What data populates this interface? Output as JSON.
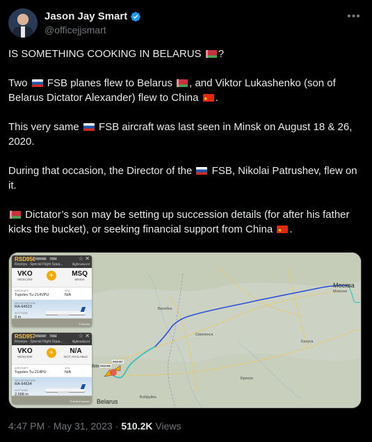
{
  "author": {
    "display_name": "Jason Jay Smart",
    "handle": "@officejjsmart",
    "verified_icon": "verified-badge-icon",
    "more_icon": "more-options-icon"
  },
  "tweet": {
    "p1": [
      "IS SOMETHING COOKING IN BELARUS ",
      "?"
    ],
    "p2": [
      "Two ",
      " FSB planes flew to Belarus ",
      ", and Viktor Lukashenko (son of Belarus Dictator Alexander) flew to China ",
      "."
    ],
    "p3": [
      "This very same ",
      " FSB aircraft was last seen in Minsk on August 18 & 26, 2020."
    ],
    "p4": [
      "During that occasion, the Director of the ",
      " FSB, Nikolai Patrushev, flew on it."
    ],
    "p5": [
      " Dictator’s son may be setting up succession details (for after his father kicks the bucket), or seeking financial support from China ",
      "."
    ]
  },
  "media": {
    "flights": [
      {
        "callsign": "RSD956",
        "chip1": "RSD956",
        "chip2": "T204",
        "airline": "Rossiya - Special Flight Squa...",
        "brand": "flightradar24",
        "from_code": "VKO",
        "from_city": "MOSCOW",
        "to_code": "MSQ",
        "to_city": "MINSK",
        "aircraft_label": "AIRCRAFT",
        "aircraft": "Tupolev Tu-214VPU",
        "sta_label": "STA",
        "sta": "N/A",
        "reg_label": "REGISTRATION",
        "reg": "RA-64523",
        "alt_label": "ALTITUDE",
        "alt": "0 m",
        "credit": "© Archer"
      },
      {
        "callsign": "RSD957",
        "chip1": "RSD957",
        "chip2": "T204",
        "airline": "Rossiya - Special Flight Squa...",
        "brand": "flightradar24",
        "from_code": "VKO",
        "from_city": "MOSCOW",
        "to_code": "N/A",
        "to_city": "NOT AVAILABLE",
        "aircraft_label": "AIRCRAFT",
        "aircraft": "Tupolev Tu-214PU",
        "sta_label": "STA",
        "sta": "N/A",
        "reg_label": "REGISTRATION",
        "reg": "RA-64534",
        "alt_label": "ALTITUDE",
        "alt": "2,598 m",
        "credit": "© Arden Isamov"
      }
    ],
    "map_labels": {
      "moscow": "Москва",
      "moscow_en": "Moscow",
      "minsk": "Минск",
      "belarus": "Belarus",
      "smolensk": "Смоленск",
      "bryansk": "Брянск",
      "kaluga": "Калуга",
      "vitebsk": "Витебск",
      "babruysk": "Бобруйск",
      "tag1": "RSD957",
      "tag2": "RSD956"
    }
  },
  "meta": {
    "time": "4:47 PM",
    "date": "May 31, 2023",
    "views_count": "510.2K",
    "views_label": "Views"
  }
}
